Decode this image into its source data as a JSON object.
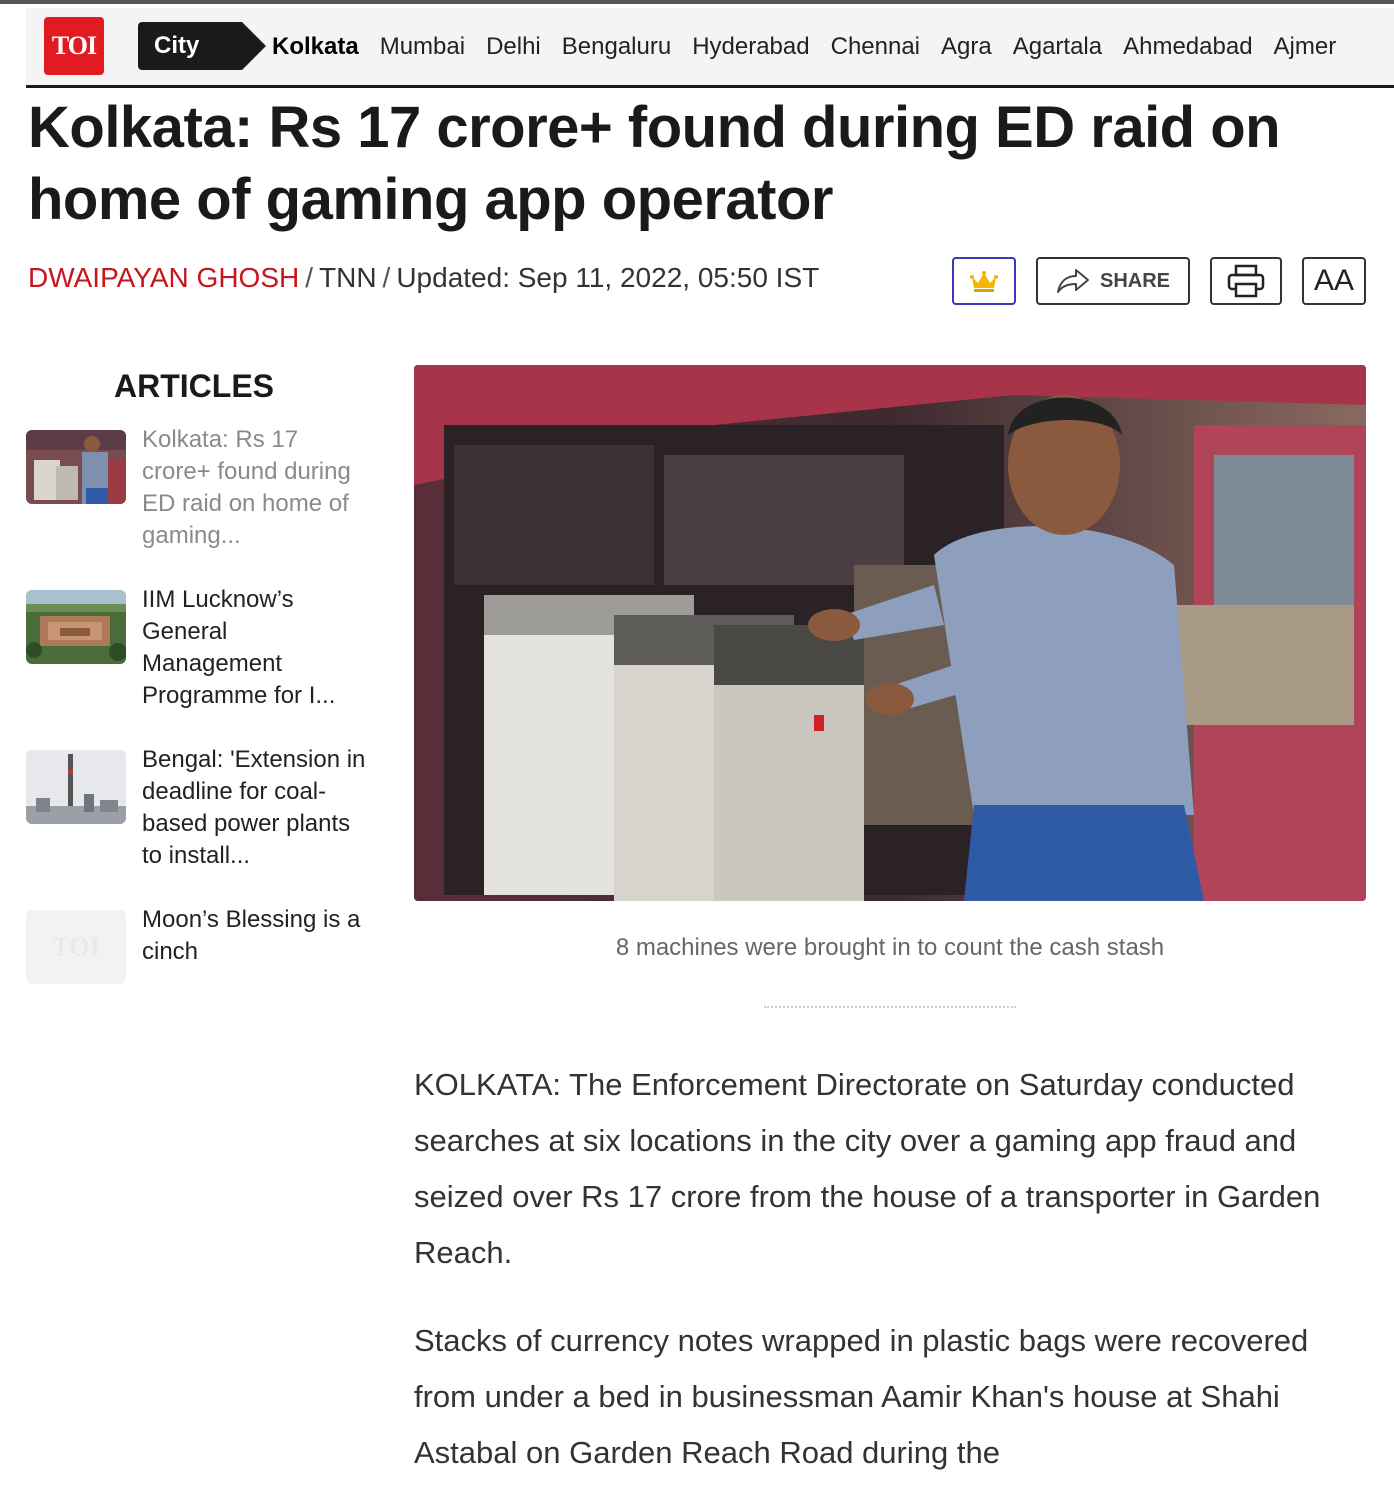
{
  "nav": {
    "logo": "TOI",
    "section": "City",
    "cities": [
      "Kolkata",
      "Mumbai",
      "Delhi",
      "Bengaluru",
      "Hyderabad",
      "Chennai",
      "Agra",
      "Agartala",
      "Ahmedabad",
      "Ajmer"
    ],
    "active_city": "Kolkata"
  },
  "article": {
    "headline": "Kolkata: Rs 17 crore+ found during ED raid on home of gaming app operator",
    "author": "DWAIPAYAN GHOSH",
    "agency": "TNN",
    "updated": "Updated: Sep 11, 2022, 05:50 IST",
    "image_caption": "8 machines were brought in to count the cash stash",
    "paragraphs": [
      "KOLKATA: The Enforcement Directorate on Saturday conducted searches at six locations in the city over a gaming app fraud and seized over Rs 17 crore from the house of a transporter in Garden Reach.",
      "Stacks of currency notes wrapped in plastic bags were recovered from under a bed in businessman Aamir Khan's house at Shahi Astabal on Garden Reach Road during the"
    ]
  },
  "toolbar": {
    "share_label": "SHARE",
    "font_label": "AA",
    "accent_color": "#3a3ab8",
    "crown_color": "#f4b400"
  },
  "sidebar": {
    "title": "ARTICLES",
    "items": [
      {
        "title": "Kolkata: Rs 17 crore+ found during ED raid on home of gaming...",
        "thumb": "raid-photo"
      },
      {
        "title": "IIM Lucknow’s General Management Programme for I...",
        "thumb": "campus-aerial"
      },
      {
        "title": "Bengal: 'Extension in deadline for coal-based power plants to install...",
        "thumb": "power-plant"
      },
      {
        "title": "Moon’s Blessing is a cinch",
        "thumb": "toi-placeholder"
      }
    ]
  },
  "colors": {
    "brand_red": "#e21b22",
    "author_red": "#c4161c"
  }
}
